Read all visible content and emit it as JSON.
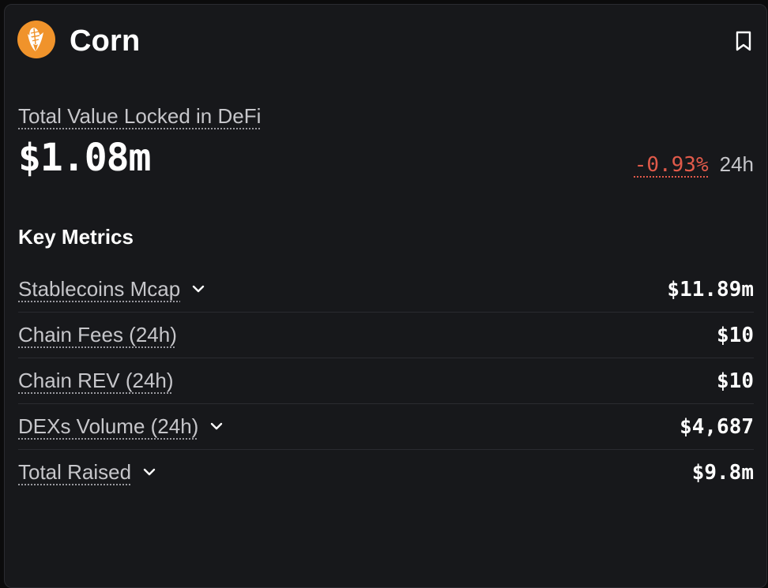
{
  "header": {
    "title": "Corn",
    "logo_icon": "corn-icon",
    "bookmark_icon": "bookmark-icon",
    "logo_color": "#f0932b"
  },
  "tvl": {
    "label": "Total Value Locked in DeFi",
    "value": "$1.08m",
    "change": "-0.93%",
    "period": "24h",
    "change_color": "#e05a4a"
  },
  "key_metrics": {
    "title": "Key Metrics",
    "rows": [
      {
        "label": "Stablecoins Mcap",
        "value": "$11.89m",
        "expandable": true
      },
      {
        "label": "Chain Fees (24h)",
        "value": "$10",
        "expandable": false
      },
      {
        "label": "Chain REV (24h)",
        "value": "$10",
        "expandable": false
      },
      {
        "label": "DEXs Volume (24h)",
        "value": "$4,687",
        "expandable": true
      },
      {
        "label": "Total Raised",
        "value": "$9.8m",
        "expandable": true
      }
    ],
    "chevron_icon": "chevron-down-icon"
  }
}
